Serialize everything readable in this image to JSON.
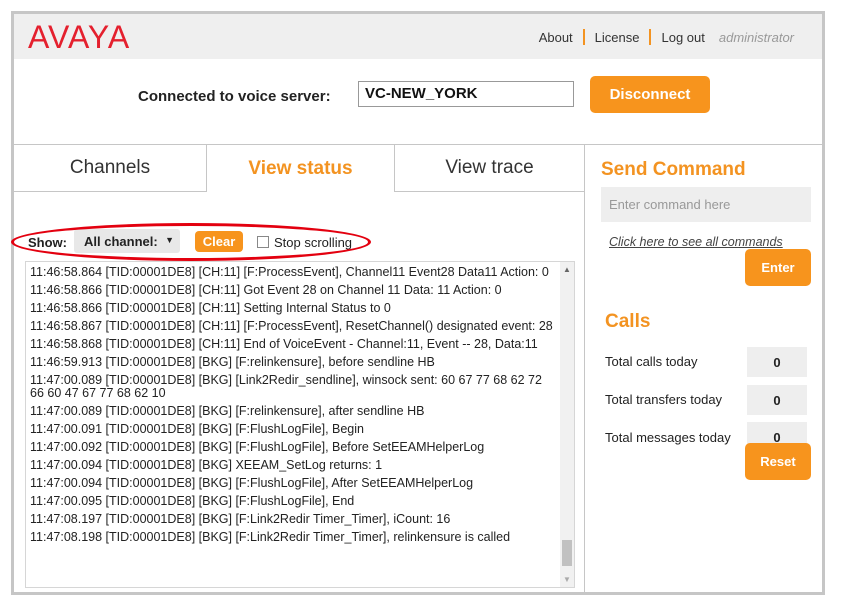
{
  "header": {
    "logo": "AVAYA",
    "links": [
      "About",
      "License",
      "Log out"
    ],
    "user": "administrator"
  },
  "connection": {
    "label": "Connected to voice server:",
    "server": "VC-NEW_YORK",
    "disconnect_label": "Disconnect"
  },
  "tabs": [
    {
      "label": "Channels",
      "active": false
    },
    {
      "label": "View status",
      "active": true
    },
    {
      "label": "View trace",
      "active": false
    }
  ],
  "filter": {
    "show_label": "Show:",
    "selected": "All channel:",
    "clear_label": "Clear",
    "stop_scrolling_label": "Stop scrolling",
    "stop_scrolling_checked": false
  },
  "log_lines": [
    "11:46:58.864 [TID:00001DE8] [CH:11] [F:ProcessEvent], Channel11 Event28 Data11 Action: 0",
    "11:46:58.866 [TID:00001DE8] [CH:11] Got Event 28 on Channel 11 Data: 11 Action: 0",
    "11:46:58.866 [TID:00001DE8] [CH:11] Setting Internal Status to 0",
    "11:46:58.867 [TID:00001DE8] [CH:11] [F:ProcessEvent], ResetChannel() designated event: 28",
    "11:46:58.868 [TID:00001DE8] [CH:11] End of VoiceEvent - Channel:11, Event -- 28, Data:11",
    "11:46:59.913 [TID:00001DE8] [BKG] [F:relinkensure], before sendline HB",
    "11:47:00.089 [TID:00001DE8] [BKG] [Link2Redir_sendline], winsock sent: 60 67 77 68 62 72 66 60 47 67 77 68 62 10",
    "11:47:00.089 [TID:00001DE8] [BKG] [F:relinkensure], after sendline HB",
    "11:47:00.091 [TID:00001DE8] [BKG] [F:FlushLogFile], Begin",
    "11:47:00.092 [TID:00001DE8] [BKG] [F:FlushLogFile], Before SetEEAMHelperLog",
    "11:47:00.094 [TID:00001DE8] [BKG] XEEAM_SetLog returns: 1",
    "11:47:00.094 [TID:00001DE8] [BKG] [F:FlushLogFile], After SetEEAMHelperLog",
    "11:47:00.095 [TID:00001DE8] [BKG] [F:FlushLogFile], End",
    "11:47:08.197 [TID:00001DE8] [BKG] [F:Link2Redir Timer_Timer], iCount: 16",
    "11:47:08.198 [TID:00001DE8] [BKG] [F:Link2Redir Timer_Timer], relinkensure is called"
  ],
  "send_command": {
    "title": "Send Command",
    "placeholder": "Enter command here",
    "link": "Click here to see all commands",
    "enter_label": "Enter"
  },
  "calls": {
    "title": "Calls",
    "stats": [
      {
        "label": "Total calls today",
        "value": "0"
      },
      {
        "label": "Total transfers today",
        "value": "0"
      },
      {
        "label": "Total messages today",
        "value": "0"
      }
    ],
    "reset_label": "Reset"
  },
  "colors": {
    "brand": "#e4202e",
    "accent": "#f7941d",
    "annotation": "#e3000f"
  }
}
